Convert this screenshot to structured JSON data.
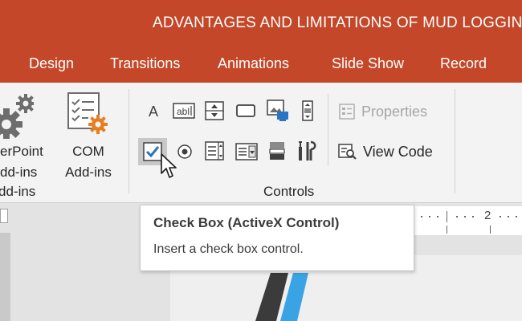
{
  "window": {
    "title": "ADVANTAGES AND LIMITATIONS OF MUD LOGGING  -"
  },
  "tabs": [
    {
      "label": "Design"
    },
    {
      "label": "Transitions"
    },
    {
      "label": "Animations"
    },
    {
      "label": "Slide Show"
    },
    {
      "label": "Record"
    }
  ],
  "ribbon": {
    "addins_group": {
      "powerpoint_addins_line1": "erPoint",
      "powerpoint_addins_line2": "dd-ins",
      "com_addins_line1": "COM",
      "com_addins_line2": "Add-ins",
      "group_label": "dd-ins"
    },
    "controls_group": {
      "group_label": "Controls",
      "icons": [
        "label-icon",
        "textbox-icon",
        "spin-button-icon",
        "command-button-icon",
        "image-control-icon",
        "scrollbar-icon",
        "checkbox-icon",
        "option-button-icon",
        "listbox-icon",
        "combobox-icon",
        "toggle-button-icon",
        "more-controls-icon"
      ],
      "properties_label": "Properties",
      "view_code_label": "View Code",
      "label_glyph": "A",
      "textbox_glyph": "abl"
    }
  },
  "ruler": {
    "mark": "2"
  },
  "tooltip": {
    "title": "Check Box (ActiveX Control)",
    "description": "Insert a check box control."
  },
  "colors": {
    "accent": "#c34728",
    "checkbox_blue": "#2b74c3",
    "gear_orange": "#e67e22",
    "slide_blue": "#3aa3e3"
  }
}
